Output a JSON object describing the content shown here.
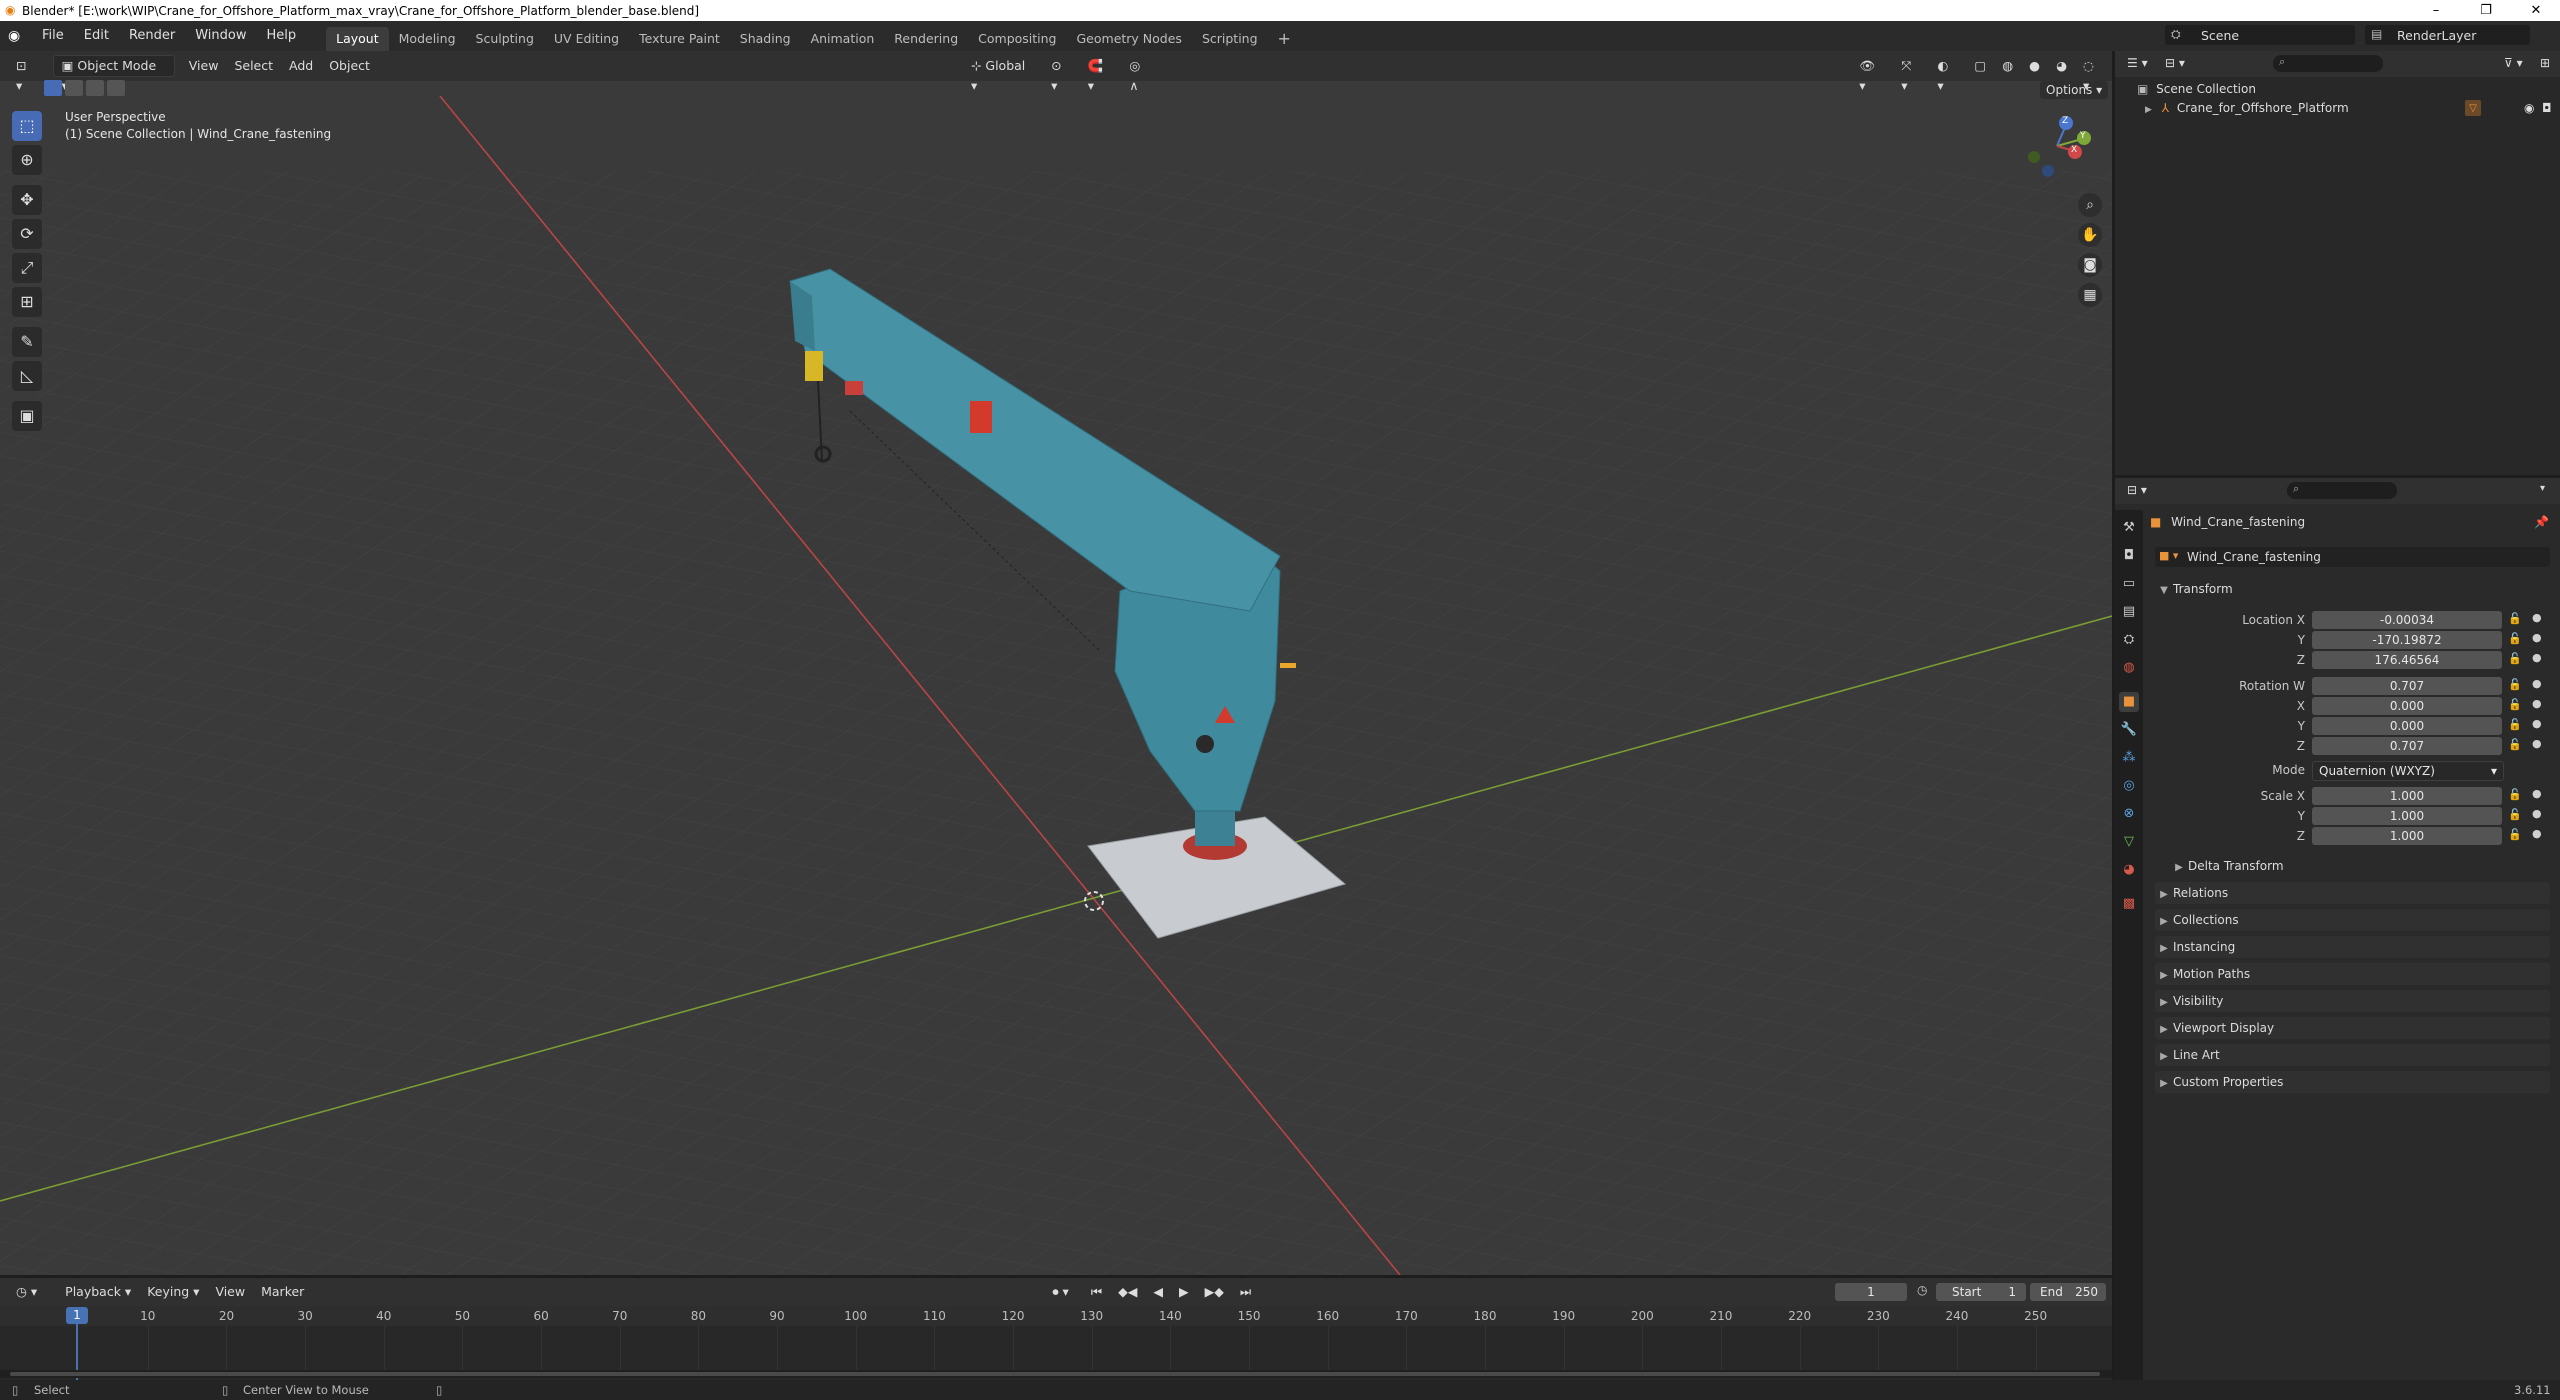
{
  "window": {
    "title": "Blender* [E:\\work\\WIP\\Crane_for_Offshore_Platform_max_vray\\Crane_for_Offshore_Platform_blender_base.blend]",
    "minimize": "–",
    "maximize": "❐",
    "close": "✕"
  },
  "menu": {
    "items": [
      "File",
      "Edit",
      "Render",
      "Window",
      "Help"
    ]
  },
  "workspaces": {
    "tabs": [
      "Layout",
      "Modeling",
      "Sculpting",
      "UV Editing",
      "Texture Paint",
      "Shading",
      "Animation",
      "Rendering",
      "Compositing",
      "Geometry Nodes",
      "Scripting"
    ],
    "active": "Layout",
    "add": "+"
  },
  "scene": {
    "name": "Scene",
    "render_layer": "RenderLayer"
  },
  "viewport": {
    "mode": "Object Mode",
    "menus": [
      "View",
      "Select",
      "Add",
      "Object"
    ],
    "transform_orientation": "Global",
    "options": "Options",
    "overlay_line1": "User Perspective",
    "overlay_line2": "(1) Scene Collection | Wind_Crane_fastening",
    "gizmo": {
      "x": "X",
      "y": "Y",
      "z": "Z"
    }
  },
  "outliner": {
    "root": "Scene Collection",
    "items": [
      {
        "label": "Crane_for_Offshore_Platform"
      }
    ]
  },
  "properties": {
    "object_name": "Wind_Crane_fastening",
    "datablock_name": "Wind_Crane_fastening",
    "transform_title": "Transform",
    "location": {
      "label": "Location X",
      "x": "-0.00034",
      "y": "-170.19872",
      "z": "176.46564"
    },
    "rotation": {
      "label": "Rotation W",
      "w": "0.707",
      "x": "0.000",
      "y": "0.000",
      "z": "0.707"
    },
    "axis_labels": {
      "x": "X",
      "y": "Y",
      "z": "Z"
    },
    "mode": {
      "label": "Mode",
      "value": "Quaternion (WXYZ)"
    },
    "scale": {
      "label": "Scale X",
      "x": "1.000",
      "y": "1.000",
      "z": "1.000"
    },
    "delta": "Delta Transform",
    "panels": [
      "Relations",
      "Collections",
      "Instancing",
      "Motion Paths",
      "Visibility",
      "Viewport Display",
      "Line Art",
      "Custom Properties"
    ]
  },
  "timeline": {
    "menus": [
      "Playback",
      "Keying",
      "View",
      "Marker"
    ],
    "current_frame": "1",
    "start_label": "Start",
    "start": "1",
    "end_label": "End",
    "end": "250",
    "ticks": [
      "10",
      "20",
      "30",
      "40",
      "50",
      "60",
      "70",
      "80",
      "90",
      "100",
      "110",
      "120",
      "130",
      "140",
      "150",
      "160",
      "170",
      "180",
      "190",
      "200",
      "210",
      "220",
      "230",
      "240",
      "250"
    ],
    "playhead": "1"
  },
  "status": {
    "select": "Select",
    "center": "Center View to Mouse",
    "version": "3.6.11"
  },
  "colors": {
    "accent": "#476bb5",
    "crane": "#3f8a9c",
    "x_axis": "#c24545",
    "y_axis": "#7fa83a"
  }
}
